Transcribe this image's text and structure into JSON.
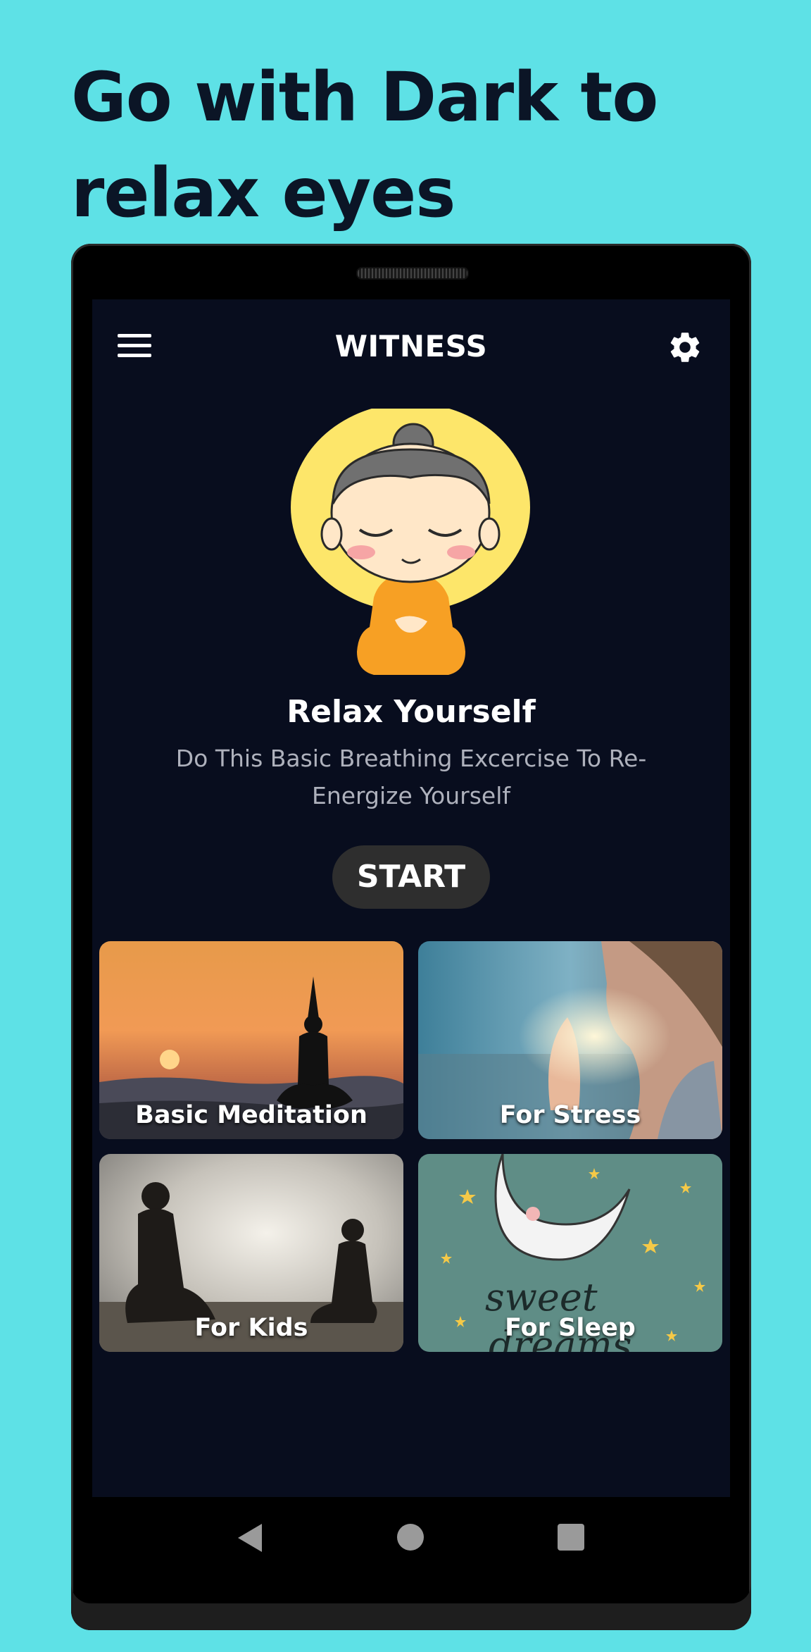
{
  "promo": {
    "line1": "Go with Dark to",
    "line2": "relax eyes"
  },
  "app": {
    "title": "WITNESS",
    "menu_icon": "hamburger-menu-icon",
    "settings_icon": "gear-icon"
  },
  "hero": {
    "title": "Relax Yourself",
    "subtitle": "Do This Basic Breathing Excercise To Re-Energize Yourself",
    "start_label": "START"
  },
  "cards": [
    {
      "label": "Basic Meditation"
    },
    {
      "label": "For Stress"
    },
    {
      "label": "For Kids"
    },
    {
      "label": "For Sleep"
    }
  ],
  "sleep_card_art_text": {
    "line1": "sweet",
    "line2": "dreams"
  },
  "colors": {
    "background": "#5ee1e6",
    "screen": "#080d1e",
    "start_button": "#2e2e2e",
    "halo": "#fde66a",
    "robe": "#f7a024"
  },
  "navbar": {
    "icons": [
      "back-icon",
      "home-icon",
      "recent-apps-icon"
    ]
  }
}
